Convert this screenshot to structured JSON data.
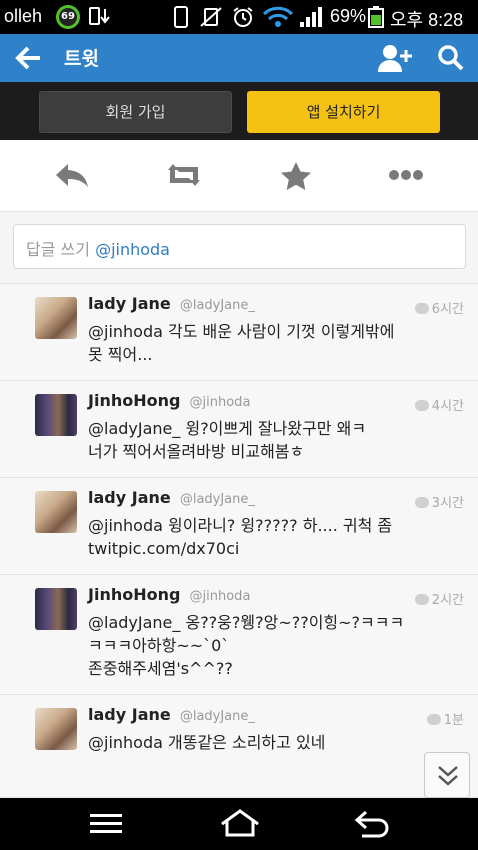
{
  "status_bar": {
    "carrier": "olleh",
    "badge": "69",
    "battery": "69%",
    "time": "오후 8:28"
  },
  "app_bar": {
    "title": "트윗"
  },
  "promo": {
    "signup_label": "회원 가입",
    "install_label": "앱 설치하기"
  },
  "reply": {
    "placeholder": "답글 쓰기",
    "mention": "@jinhoda"
  },
  "tweets": [
    {
      "name": "lady Jane",
      "handle": "@ladyJane_",
      "time": "6시간",
      "text": "@jinhoda 각도 배운 사람이 기껏 이렇게밖에\n못 찍어..."
    },
    {
      "name": "JinhoHong",
      "handle": "@jinhoda",
      "time": "4시간",
      "text": "@ladyJane_ 윙?이쁘게 잘나왔구만 왜ㅋ\n너가 찍어서올려바방 비교해봄ㅎ"
    },
    {
      "name": "lady Jane",
      "handle": "@ladyJane_",
      "time": "3시간",
      "text": "@jinhoda 윙이라니? 윙????? 하.... 귀척 좀\ntwitpic.com/dx70ci"
    },
    {
      "name": "JinhoHong",
      "handle": "@jinhoda",
      "time": "2시간",
      "text": "@ladyJane_ 옹??웅?웽?앙~??이힝~?ㅋㅋㅋ\nㅋㅋㅋ아하항~~`0`\n존중해주세염's^^??"
    },
    {
      "name": "lady Jane",
      "handle": "@ladyJane_",
      "time": "1분",
      "text": "@jinhoda 개똥같은 소리하고 있네"
    }
  ]
}
